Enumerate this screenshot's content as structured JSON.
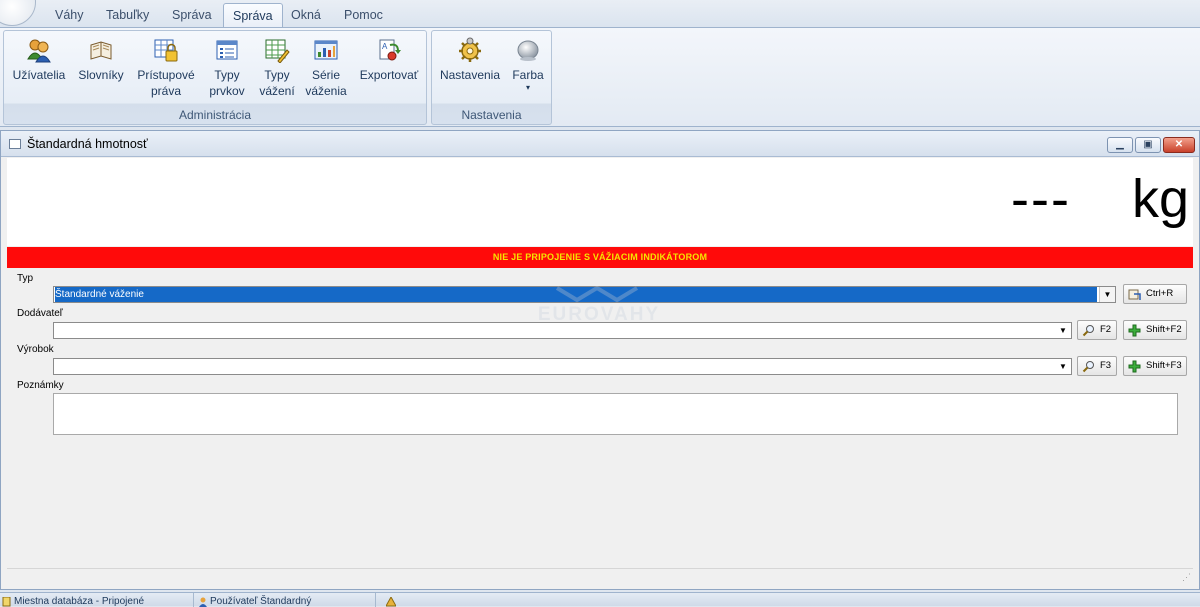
{
  "ribbon": {
    "tabs": [
      "Váhy",
      "Tabuľky",
      "Správa",
      "Správa",
      "Okná",
      "Pomoc"
    ],
    "active_tab_index": 3,
    "groups": {
      "administracia": {
        "caption": "Administrácia",
        "buttons": [
          {
            "line1": "Užívatelia",
            "line2": "",
            "icon": "users-icon"
          },
          {
            "line1": "Slovníky",
            "line2": "",
            "icon": "book-icon"
          },
          {
            "line1": "Prístupové",
            "line2": "práva",
            "icon": "lock-table-icon"
          },
          {
            "line1": "Typy",
            "line2": "prvkov",
            "icon": "list-icon"
          },
          {
            "line1": "Typy",
            "line2": "vážení",
            "icon": "edit-table-icon"
          },
          {
            "line1": "Série",
            "line2": "váženia",
            "icon": "chart-icon"
          },
          {
            "line1": "Exportovať",
            "line2": "",
            "icon": "export-icon"
          }
        ]
      },
      "nastavenia": {
        "caption": "Nastavenia",
        "buttons": [
          {
            "line1": "Nastavenia",
            "line2": "",
            "icon": "gears-icon"
          },
          {
            "line1": "Farba",
            "line2": "▾",
            "icon": "color-orb-icon"
          }
        ]
      }
    }
  },
  "window": {
    "title": "Štandardná hmotnosť",
    "weight_display": "---",
    "unit": "kg",
    "alarm_text": "NIE JE PRIPOJENIE S VÁŽIACIM INDIKÁTOROM",
    "watermark": "EUROVAHY"
  },
  "form": {
    "typ": {
      "label": "Typ",
      "value": "Štandardné váženie",
      "button": "Ctrl+R"
    },
    "dodavatel": {
      "label": "Dodávateľ",
      "value": "",
      "search_button": "F2",
      "add_button": "Shift+F2"
    },
    "vyrobok": {
      "label": "Výrobok",
      "value": "",
      "search_button": "F3",
      "add_button": "Shift+F3"
    },
    "poznamky": {
      "label": "Poznámky",
      "value": ""
    }
  },
  "statusbar": {
    "database": "Miestna databáza - Pripojené",
    "user": "Používateľ Štandardný"
  },
  "colors": {
    "alarm_bg": "#ff0a0a",
    "alarm_text": "#f6e400",
    "selection": "#1569c7",
    "ribbon_text": "#1e395b"
  }
}
